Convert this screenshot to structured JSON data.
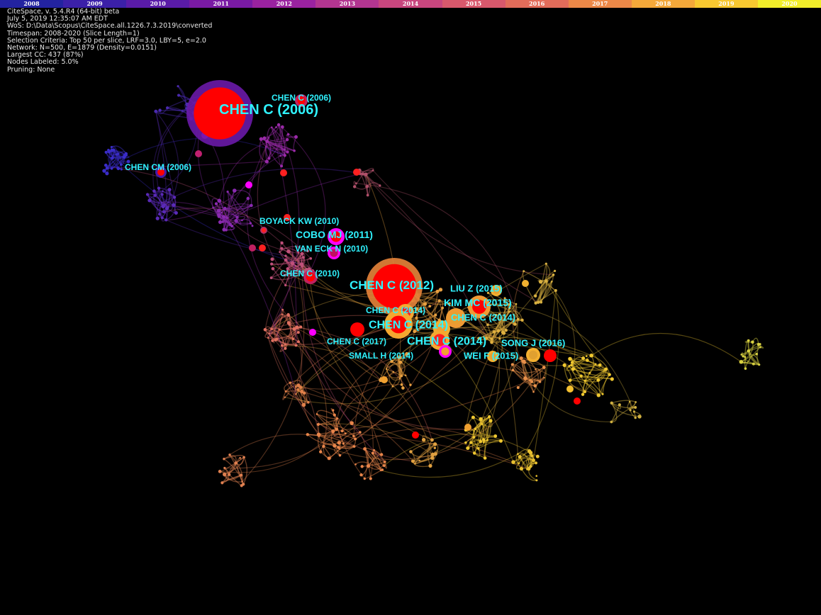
{
  "timeline": {
    "slices": [
      {
        "year": "2008",
        "color": "#2323a0"
      },
      {
        "year": "2009",
        "color": "#3b20a8"
      },
      {
        "year": "2010",
        "color": "#5a1ba8"
      },
      {
        "year": "2011",
        "color": "#7a1aa5"
      },
      {
        "year": "2012",
        "color": "#9a22a0"
      },
      {
        "year": "2013",
        "color": "#b23590"
      },
      {
        "year": "2014",
        "color": "#c8467e"
      },
      {
        "year": "2015",
        "color": "#d8586c"
      },
      {
        "year": "2016",
        "color": "#e26c5a"
      },
      {
        "year": "2017",
        "color": "#ec8848"
      },
      {
        "year": "2018",
        "color": "#f4a83a"
      },
      {
        "year": "2019",
        "color": "#f8c830"
      },
      {
        "year": "2020",
        "color": "#f2ee2a"
      }
    ]
  },
  "info": {
    "lines": [
      "CiteSpace, v. 5.4.R4 (64-bit) beta",
      "July 5, 2019 12:35:07 AM EDT",
      "WoS: D:\\Data\\Scopus\\CiteSpace.all.1226.7.3.2019\\converted",
      "Timespan: 2008-2020 (Slice Length=1)",
      "Selection Criteria: Top 50 per slice, LRF=3.0, LBY=5, e=2.0",
      "Network: N=500, E=1879 (Density=0.0151)",
      "Largest CC: 437 (87%)",
      "Nodes Labeled: 5.0%",
      "Pruning: None"
    ]
  },
  "network": {
    "key_nodes": [
      {
        "label": "CHEN C (2006)",
        "r": 47,
        "ring": "#6a1aa8",
        "core": "#ff0000"
      },
      {
        "label": "CHEN C (2006)",
        "r": 9,
        "ring": "#c02060",
        "core": "#ff0000"
      },
      {
        "label": "CHEN CM (2006)",
        "r": 8,
        "ring": "#4a1aa8",
        "core": "#ff0000"
      },
      {
        "label": "BOYACK KW (2010)",
        "r": 5,
        "ring": "#b0306a",
        "core": "#ff2020"
      },
      {
        "label": "COBO MJ (2011)",
        "r": 12,
        "ring": "#ff00ff",
        "core": "#ff0000"
      },
      {
        "label": "VAN ECK N (2010)",
        "r": 9,
        "ring": "#ff00ff",
        "core": "#c01060"
      },
      {
        "label": "CHEN C (2010)",
        "r": 10,
        "ring": "#c02060",
        "core": "#ff0000"
      },
      {
        "label": "CHEN C (2012)",
        "r": 40,
        "ring": "#e8843a",
        "core": "#ff0000"
      },
      {
        "label": "LIU Z (2015)",
        "r": 8,
        "ring": "#f4b030",
        "core": "#e8a030"
      },
      {
        "label": "KIM MC (2015)",
        "r": 16,
        "ring": "#f09a34",
        "core": "#ff0000"
      },
      {
        "label": "CHEN C (2014)",
        "r": 12,
        "ring": "#f4a830",
        "core": "#ff2020"
      },
      {
        "label": "CHEN C (2014)",
        "r": 14,
        "ring": "#f09a34",
        "core": "#e8a030"
      },
      {
        "label": "CHEN C (2014)",
        "r": 20,
        "ring": "#f4a830",
        "core": "#ff0000"
      },
      {
        "label": "CHEN C (2014)",
        "r": 12,
        "ring": "#f0b030",
        "core": "#f0a030"
      },
      {
        "label": "CHEN C (2017)",
        "r": 10,
        "ring": "#ff0000",
        "core": "#ff0000"
      },
      {
        "label": "CHEN C (2014)",
        "r": 14,
        "ring": "#f4a830",
        "core": "#ff2020"
      },
      {
        "label": "SMALL H (2014)",
        "r": 9,
        "ring": "#ff00ff",
        "core": "#f0a030"
      },
      {
        "label": "WEI F (2015)",
        "r": 8,
        "ring": "#f4b030",
        "core": "#e8a030"
      },
      {
        "label": "SONG J (2016)",
        "r": 10,
        "ring": "#f4b030",
        "core": "#e0a030"
      },
      {
        "label": "",
        "r": 9,
        "ring": "#ff0000",
        "core": "#ff0000"
      }
    ]
  }
}
